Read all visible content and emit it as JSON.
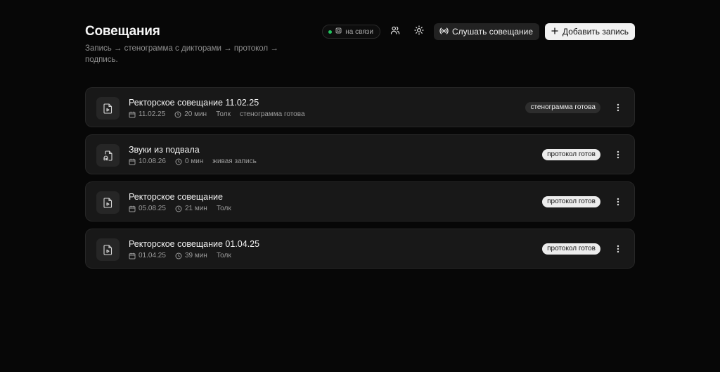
{
  "header": {
    "title": "Совещания",
    "subtitle": "Запись → стенограмма с дикторами → протокол → подпись."
  },
  "toolbar": {
    "status_label": "на связи",
    "status_color": "#22c55e",
    "users_icon": "users-icon",
    "theme_icon": "sun-icon",
    "listen_label": "Слушать совещание",
    "add_label": "Добавить запись"
  },
  "meetings": [
    {
      "title": "Ректорское совещание 11.02.25",
      "date": "11.02.25",
      "duration": "20 мин",
      "source": "Толк",
      "status_text": "стенограмма готова",
      "badge": "стенограмма готова",
      "badge_style": "dark",
      "icon": "file-video-icon"
    },
    {
      "title": "Звуки из подвала",
      "date": "10.08.26",
      "duration": "0 мин",
      "source": "живая запись",
      "status_text": "",
      "badge": "протокол готов",
      "badge_style": "light",
      "icon": "file-audio-icon"
    },
    {
      "title": "Ректорское совещание",
      "date": "05.08.25",
      "duration": "21 мин",
      "source": "Толк",
      "status_text": "",
      "badge": "протокол готов",
      "badge_style": "light",
      "icon": "file-video-icon"
    },
    {
      "title": "Ректорское совещание 01.04.25",
      "date": "01.04.25",
      "duration": "39 мин",
      "source": "Толк",
      "status_text": "",
      "badge": "протокол готов",
      "badge_style": "light",
      "icon": "file-video-icon"
    }
  ]
}
